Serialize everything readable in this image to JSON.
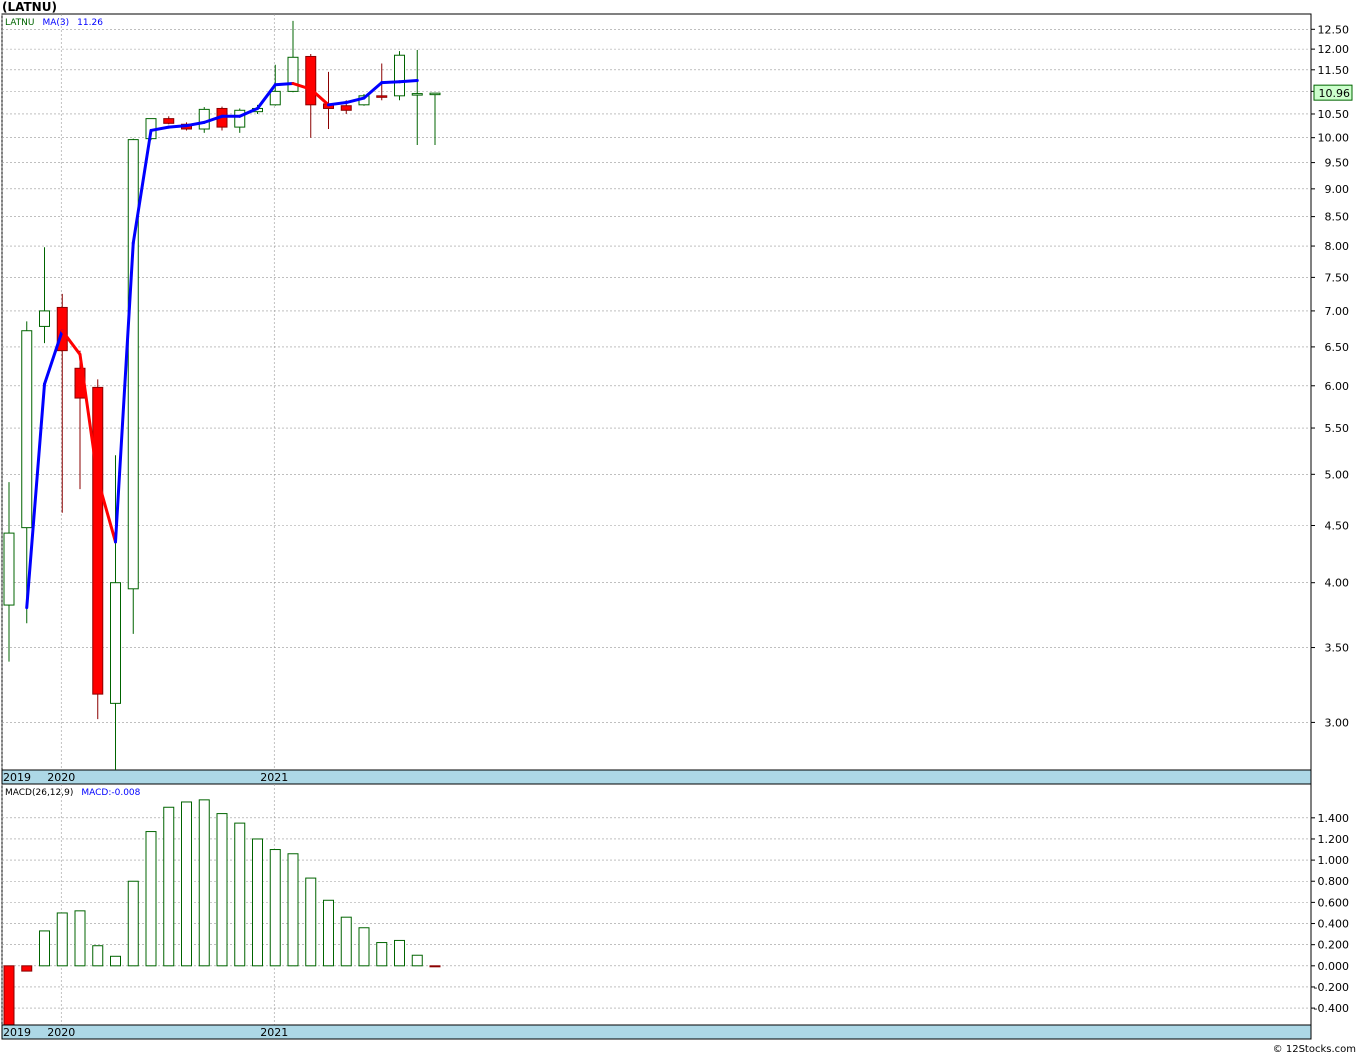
{
  "title": "(LATNU)",
  "footer": "© 12Stocks.com",
  "colors": {
    "up": "#006400",
    "down": "#ff0000",
    "ma_up": "#0000ff",
    "ma_down": "#ff0000",
    "axis_band": "#add8e6",
    "grid": "#999999"
  },
  "chart_data": [
    {
      "type": "candlestick",
      "legend": {
        "ticker": "LATNU",
        "ma_label": "MA(3)",
        "ma_value": "11.26"
      },
      "y_scale": "log",
      "ylim": [
        2.72,
        12.9
      ],
      "y_ticks": [
        "3.00",
        "3.50",
        "4.00",
        "4.50",
        "5.00",
        "5.50",
        "6.00",
        "6.50",
        "7.00",
        "7.50",
        "8.00",
        "8.50",
        "9.00",
        "9.50",
        "10.00",
        "10.50",
        "11.00",
        "11.50",
        "12.00",
        "12.50"
      ],
      "x_labels": [
        {
          "label": "2019",
          "index": 0
        },
        {
          "label": "2020",
          "index": 3
        },
        {
          "label": "2021",
          "index": 15
        }
      ],
      "last_price": "10.96",
      "candles": [
        {
          "o": 3.82,
          "h": 4.92,
          "l": 3.4,
          "c": 4.43
        },
        {
          "o": 4.48,
          "h": 6.85,
          "l": 3.68,
          "c": 6.72
        },
        {
          "o": 6.78,
          "h": 7.98,
          "l": 6.55,
          "c": 7.0
        },
        {
          "o": 7.05,
          "h": 7.25,
          "l": 4.62,
          "c": 6.45
        },
        {
          "o": 6.22,
          "h": 6.45,
          "l": 4.85,
          "c": 5.85
        },
        {
          "o": 5.98,
          "h": 6.08,
          "l": 3.02,
          "c": 3.18
        },
        {
          "o": 3.12,
          "h": 5.2,
          "l": 2.72,
          "c": 4.0
        },
        {
          "o": 3.95,
          "h": 9.98,
          "l": 3.6,
          "c": 9.96
        },
        {
          "o": 9.98,
          "h": 10.4,
          "l": 9.95,
          "c": 10.4
        },
        {
          "o": 10.4,
          "h": 10.45,
          "l": 10.28,
          "c": 10.3
        },
        {
          "o": 10.28,
          "h": 10.32,
          "l": 10.15,
          "c": 10.18
        },
        {
          "o": 10.18,
          "h": 10.65,
          "l": 10.1,
          "c": 10.6
        },
        {
          "o": 10.62,
          "h": 10.66,
          "l": 10.15,
          "c": 10.22
        },
        {
          "o": 10.22,
          "h": 10.62,
          "l": 10.1,
          "c": 10.58
        },
        {
          "o": 10.55,
          "h": 10.7,
          "l": 10.5,
          "c": 10.62
        },
        {
          "o": 10.7,
          "h": 11.62,
          "l": 10.68,
          "c": 11.0
        },
        {
          "o": 11.0,
          "h": 12.72,
          "l": 10.98,
          "c": 11.8
        },
        {
          "o": 11.82,
          "h": 11.88,
          "l": 10.0,
          "c": 10.7
        },
        {
          "o": 10.72,
          "h": 11.45,
          "l": 10.18,
          "c": 10.62
        },
        {
          "o": 10.68,
          "h": 10.8,
          "l": 10.5,
          "c": 10.58
        },
        {
          "o": 10.7,
          "h": 10.94,
          "l": 10.68,
          "c": 10.9
        },
        {
          "o": 10.9,
          "h": 11.65,
          "l": 10.8,
          "c": 10.88
        },
        {
          "o": 10.9,
          "h": 11.95,
          "l": 10.8,
          "c": 11.85
        },
        {
          "o": 10.92,
          "h": 11.98,
          "l": 9.85,
          "c": 10.95
        },
        {
          "o": 10.96,
          "h": 10.97,
          "l": 9.85,
          "c": 10.96
        }
      ],
      "ma": [
        null,
        3.8,
        6.02,
        6.72,
        6.4,
        4.95,
        4.35,
        8.05,
        10.15,
        10.22,
        10.25,
        10.32,
        10.45,
        10.45,
        10.62,
        11.15,
        11.18,
        11.05,
        10.7,
        10.75,
        10.85,
        11.2,
        11.22,
        11.25
      ]
    },
    {
      "type": "bar",
      "legend": {
        "label": "MACD(26,12,9)",
        "value_label": "MACD:-0.008"
      },
      "ylim": [
        -0.56,
        1.72
      ],
      "y_ticks": [
        "-0.400",
        "-0.200",
        "0.000",
        "0.200",
        "0.400",
        "0.600",
        "0.800",
        "1.000",
        "1.200",
        "1.400"
      ],
      "x_labels": [
        {
          "label": "2019",
          "index": 0
        },
        {
          "label": "2020",
          "index": 3
        },
        {
          "label": "2021",
          "index": 15
        }
      ],
      "values": [
        -0.56,
        -0.05,
        0.33,
        0.5,
        0.52,
        0.19,
        0.09,
        0.8,
        1.27,
        1.5,
        1.55,
        1.57,
        1.44,
        1.35,
        1.2,
        1.1,
        1.06,
        0.83,
        0.62,
        0.46,
        0.36,
        0.22,
        0.24,
        0.1,
        -0.008
      ]
    }
  ]
}
